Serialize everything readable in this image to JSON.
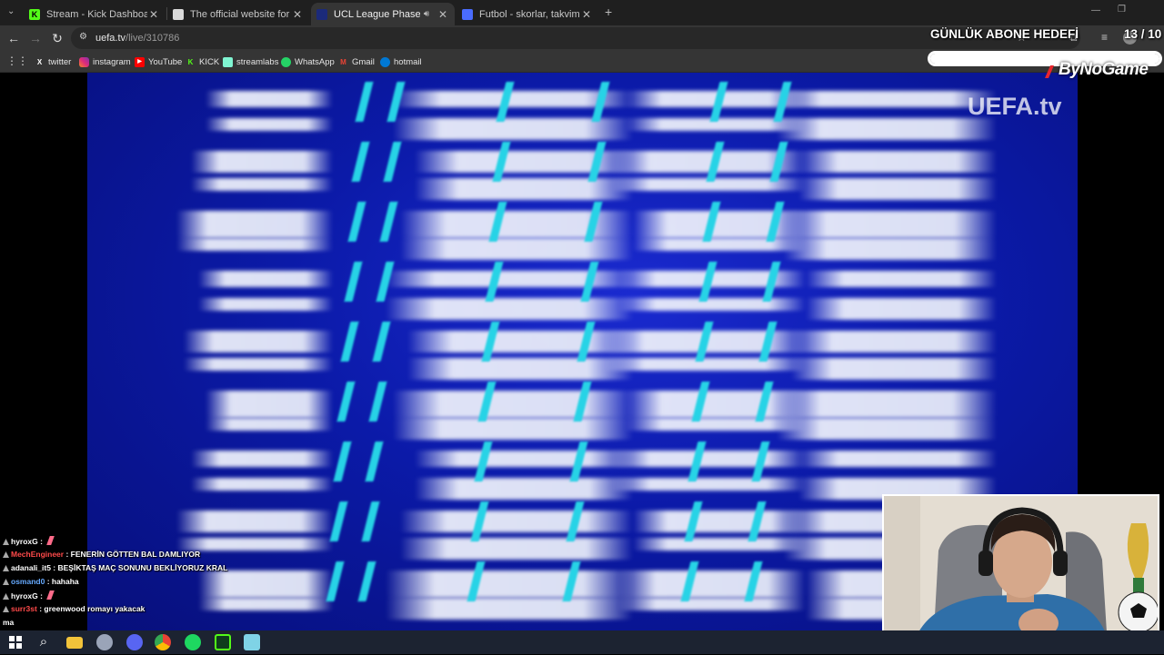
{
  "browser": {
    "tabs": [
      {
        "title": "Stream - Kick Dashboard",
        "favicon_color": "#53fc18",
        "favicon_glyph": "K",
        "active": false
      },
      {
        "title": "The official website for European",
        "favicon_color": "#d9d9d9",
        "favicon_glyph": "",
        "active": false
      },
      {
        "title": "UCL League Phase Draw",
        "favicon_color": "#1b2a7a",
        "favicon_glyph": "",
        "active": true,
        "audio": true
      },
      {
        "title": "Futbol - skorlar, takvim & oran",
        "favicon_color": "#4a6cff",
        "favicon_glyph": "",
        "active": false
      }
    ],
    "url_host": "uefa.tv",
    "url_path": "/live/310786",
    "bookmarks": [
      {
        "label": "twitter",
        "icon": "x-icon",
        "color": "#000000",
        "glyph": "X"
      },
      {
        "label": "instagram",
        "icon": "instagram-icon",
        "color": "#e1306c",
        "glyph": ""
      },
      {
        "label": "YouTube",
        "icon": "youtube-icon",
        "color": "#ff0000",
        "glyph": "▶"
      },
      {
        "label": "KICK",
        "icon": "kick-icon",
        "color": "#53fc18",
        "glyph": "K"
      },
      {
        "label": "streamlabs",
        "icon": "streamlabs-icon",
        "color": "#80f5d2",
        "glyph": ""
      },
      {
        "label": "WhatsApp",
        "icon": "whatsapp-icon",
        "color": "#25d366",
        "glyph": ""
      },
      {
        "label": "Gmail",
        "icon": "gmail-icon",
        "color": "#ea4335",
        "glyph": "M"
      },
      {
        "label": "hotmail",
        "icon": "hotmail-icon",
        "color": "#0078d4",
        "glyph": ""
      }
    ]
  },
  "video": {
    "logo": "UEFA.tv"
  },
  "overlay": {
    "goal_title": "GÜNLÜK ABONE HEDEFİ",
    "goal_count": "13 / 10",
    "goal_progress": 1.0,
    "sponsor": "ByNoGame"
  },
  "chat": [
    {
      "user": "hyroxG",
      "user_color": "#ffffff",
      "message": "",
      "has_emote": true
    },
    {
      "user": "MechEngineer",
      "user_color": "#ff4a4a",
      "message": "FENERİN GÖTTEN BAL DAMLIYOR",
      "has_emote": false
    },
    {
      "user": "adanali_it5",
      "user_color": "#ffffff",
      "message": "BEŞİKTAŞ MAÇ SONUNU BEKLİYORUZ KRAL",
      "has_emote": false
    },
    {
      "user": "osmand0",
      "user_color": "#66aaff",
      "message": "hahaha",
      "has_emote": false
    },
    {
      "user": "hyroxG",
      "user_color": "#ffffff",
      "message": "",
      "has_emote": true
    },
    {
      "user": "surr3st",
      "user_color": "#ff4a4a",
      "message": "greenwood romayı yakacak",
      "has_emote": false
    },
    {
      "user": "",
      "user_color": "#ffffff",
      "message": "ma",
      "has_emote": false
    }
  ],
  "taskbar": {
    "icons": [
      "windows-start-icon",
      "search-icon",
      "file-explorer-icon",
      "app-icon",
      "discord-icon",
      "chrome-icon",
      "spotify-icon",
      "kick-icon",
      "notepad-icon"
    ]
  }
}
